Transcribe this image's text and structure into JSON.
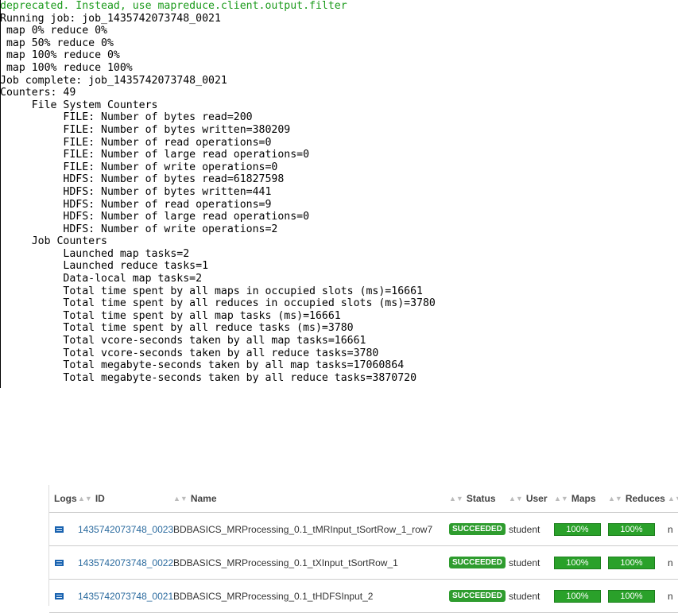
{
  "console": {
    "lines": [
      {
        "text": "deprecated. Instead, use mapreduce.client.output.filter",
        "color": "green"
      },
      {
        "text": "Running job: job_1435742073748_0021"
      },
      {
        "text": " map 0% reduce 0%"
      },
      {
        "text": " map 50% reduce 0%"
      },
      {
        "text": " map 100% reduce 0%"
      },
      {
        "text": " map 100% reduce 100%"
      },
      {
        "text": "Job complete: job_1435742073748_0021"
      },
      {
        "text": "Counters: 49"
      },
      {
        "text": "     File System Counters"
      },
      {
        "text": "          FILE: Number of bytes read=200"
      },
      {
        "text": "          FILE: Number of bytes written=380209"
      },
      {
        "text": "          FILE: Number of read operations=0"
      },
      {
        "text": "          FILE: Number of large read operations=0"
      },
      {
        "text": "          FILE: Number of write operations=0"
      },
      {
        "text": "          HDFS: Number of bytes read=61827598"
      },
      {
        "text": "          HDFS: Number of bytes written=441"
      },
      {
        "text": "          HDFS: Number of read operations=9"
      },
      {
        "text": "          HDFS: Number of large read operations=0"
      },
      {
        "text": "          HDFS: Number of write operations=2"
      },
      {
        "text": "     Job Counters"
      },
      {
        "text": "          Launched map tasks=2"
      },
      {
        "text": "          Launched reduce tasks=1"
      },
      {
        "text": "          Data-local map tasks=2"
      },
      {
        "text": "          Total time spent by all maps in occupied slots (ms)=16661"
      },
      {
        "text": "          Total time spent by all reduces in occupied slots (ms)=3780"
      },
      {
        "text": "          Total time spent by all map tasks (ms)=16661"
      },
      {
        "text": "          Total time spent by all reduce tasks (ms)=3780"
      },
      {
        "text": "          Total vcore-seconds taken by all map tasks=16661"
      },
      {
        "text": "          Total vcore-seconds taken by all reduce tasks=3780"
      },
      {
        "text": "          Total megabyte-seconds taken by all map tasks=17060864"
      },
      {
        "text": "          Total megabyte-seconds taken by all reduce tasks=3870720"
      }
    ]
  },
  "table": {
    "headers": {
      "logs": "Logs",
      "id": "ID",
      "name": "Name",
      "status": "Status",
      "user": "User",
      "maps": "Maps",
      "reduces": "Reduces"
    },
    "rows": [
      {
        "id": "143574207374​8_0023",
        "name": "BDBASICS_MRProcessing_0.1_tMRInput_tSortRow_1_row7",
        "status": "SUCCEEDED",
        "user": "student",
        "maps": "100%",
        "reduces": "100%"
      },
      {
        "id": "143574207374​8_0022",
        "name": "BDBASICS_MRProcessing_0.1_tXInput_tSortRow_1",
        "status": "SUCCEEDED",
        "user": "student",
        "maps": "100%",
        "reduces": "100%"
      },
      {
        "id": "143574207374​8_0021",
        "name": "BDBASICS_MRProcessing_0.1_tHDFSInput_2",
        "status": "SUCCEEDED",
        "user": "student",
        "maps": "100%",
        "reduces": "100%"
      }
    ]
  },
  "colors": {
    "console_green": "#1a9a1a",
    "status_green": "#2e9c2e",
    "bar_green": "#2aa12a",
    "link_blue": "#2a6a9e"
  }
}
